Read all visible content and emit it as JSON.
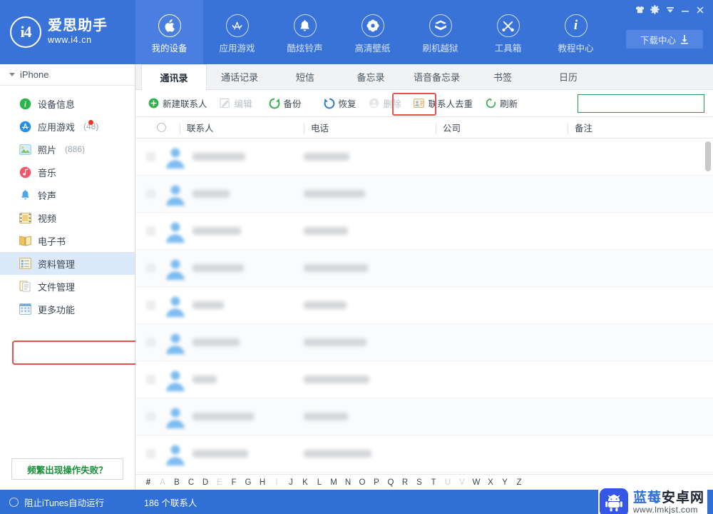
{
  "brand": {
    "logo_text": "i4",
    "name": "爱思助手",
    "url": "www.i4.cn",
    "logo_icon": "i4-circle-logo"
  },
  "topnav": {
    "items": [
      {
        "label": "我的设备",
        "icon": "apple-icon",
        "active": true
      },
      {
        "label": "应用游戏",
        "icon": "appstore-icon",
        "active": false
      },
      {
        "label": "酷炫铃声",
        "icon": "bell-icon",
        "active": false
      },
      {
        "label": "高清壁纸",
        "icon": "flower-wallpaper-icon",
        "active": false
      },
      {
        "label": "刷机越狱",
        "icon": "open-box-icon",
        "active": false
      },
      {
        "label": "工具箱",
        "icon": "tools-icon",
        "active": false
      },
      {
        "label": "教程中心",
        "icon": "info-icon",
        "active": false
      }
    ]
  },
  "window": {
    "buttons": [
      {
        "name": "skin-icon",
        "glyph": "👕"
      },
      {
        "name": "gear-icon",
        "glyph": "✾"
      },
      {
        "name": "tray-down-icon",
        "glyph": "▼"
      },
      {
        "name": "minimize-icon",
        "glyph": "—"
      },
      {
        "name": "close-icon",
        "glyph": "✕"
      }
    ],
    "download_center": {
      "label": "下载中心",
      "icon": "download-icon"
    }
  },
  "sidebar": {
    "device": {
      "label": "iPhone",
      "icon": "collapse-triangle-icon"
    },
    "items": [
      {
        "label": "设备信息",
        "count": "",
        "icon": "info-circle-icon",
        "badge": false,
        "selected": false
      },
      {
        "label": "应用游戏",
        "count": "(48)",
        "icon": "appstore-circle-icon",
        "badge": true,
        "selected": false
      },
      {
        "label": "照片",
        "count": "(886)",
        "icon": "photo-icon",
        "badge": false,
        "selected": false
      },
      {
        "label": "音乐",
        "count": "",
        "icon": "music-icon",
        "badge": false,
        "selected": false
      },
      {
        "label": "铃声",
        "count": "",
        "icon": "ringtone-bell-icon",
        "badge": false,
        "selected": false
      },
      {
        "label": "视频",
        "count": "",
        "icon": "video-film-icon",
        "badge": false,
        "selected": false
      },
      {
        "label": "电子书",
        "count": "",
        "icon": "ebook-icon",
        "badge": false,
        "selected": false
      },
      {
        "label": "资料管理",
        "count": "",
        "icon": "data-manage-icon",
        "badge": false,
        "selected": true
      },
      {
        "label": "文件管理",
        "count": "",
        "icon": "file-manage-icon",
        "badge": false,
        "selected": false
      },
      {
        "label": "更多功能",
        "count": "",
        "icon": "more-features-icon",
        "badge": false,
        "selected": false
      }
    ],
    "fail_button": {
      "label": "频繁出现操作失败？"
    }
  },
  "tabs": [
    {
      "label": "通讯录",
      "active": true
    },
    {
      "label": "通话记录",
      "active": false
    },
    {
      "label": "短信",
      "active": false
    },
    {
      "label": "备忘录",
      "active": false
    },
    {
      "label": "语音备忘录",
      "active": false
    },
    {
      "label": "书签",
      "active": false
    },
    {
      "label": "日历",
      "active": false
    }
  ],
  "toolbar": {
    "buttons": [
      {
        "label": "新建联系人",
        "icon": "plus-circle-icon",
        "disabled": false,
        "highlighted": false
      },
      {
        "label": "编辑",
        "icon": "pencil-edit-icon",
        "disabled": true,
        "highlighted": false
      },
      {
        "label": "备份",
        "icon": "backup-circle-arrow-icon",
        "disabled": false,
        "highlighted": true
      },
      {
        "label": "恢复",
        "icon": "restore-circle-arrow-icon",
        "disabled": false,
        "highlighted": false
      },
      {
        "label": "删除",
        "icon": "delete-person-icon",
        "disabled": true,
        "highlighted": false
      },
      {
        "label": "联系人去重",
        "icon": "dedupe-card-icon",
        "disabled": false,
        "highlighted": false
      },
      {
        "label": "刷新",
        "icon": "refresh-icon",
        "disabled": false,
        "highlighted": false
      }
    ],
    "search": {
      "value": "",
      "placeholder": "",
      "icon": "search-icon"
    }
  },
  "table": {
    "columns": [
      "联系人",
      "电话",
      "公司",
      "备注"
    ],
    "select_all_icon": "select-all-circle-icon",
    "rows": [
      {
        "name": "",
        "phone": "",
        "company": "",
        "note": "",
        "name_w": 78,
        "phone_w": 95
      },
      {
        "name": "",
        "phone": "",
        "company": "",
        "note": "",
        "name_w": 86,
        "phone_w": 62
      },
      {
        "name": "",
        "phone": "",
        "company": "",
        "note": "",
        "name_w": 34,
        "phone_w": 92
      },
      {
        "name": "",
        "phone": "",
        "company": "",
        "note": "",
        "name_w": 66,
        "phone_w": 88
      },
      {
        "name": "",
        "phone": "",
        "company": "",
        "note": "",
        "name_w": 44,
        "phone_w": 60
      },
      {
        "name": "",
        "phone": "",
        "company": "",
        "note": "",
        "name_w": 72,
        "phone_w": 90
      },
      {
        "name": "",
        "phone": "",
        "company": "",
        "note": "",
        "name_w": 68,
        "phone_w": 62
      },
      {
        "name": "",
        "phone": "",
        "company": "",
        "note": "",
        "name_w": 52,
        "phone_w": 86
      },
      {
        "name": "",
        "phone": "",
        "company": "",
        "note": "",
        "name_w": 74,
        "phone_w": 64
      }
    ]
  },
  "alphabet": [
    {
      "ch": "#",
      "enabled": true
    },
    {
      "ch": "A",
      "enabled": false
    },
    {
      "ch": "B",
      "enabled": true
    },
    {
      "ch": "C",
      "enabled": true
    },
    {
      "ch": "D",
      "enabled": true
    },
    {
      "ch": "E",
      "enabled": false
    },
    {
      "ch": "F",
      "enabled": true
    },
    {
      "ch": "G",
      "enabled": true
    },
    {
      "ch": "H",
      "enabled": true
    },
    {
      "ch": "I",
      "enabled": false
    },
    {
      "ch": "J",
      "enabled": true
    },
    {
      "ch": "K",
      "enabled": true
    },
    {
      "ch": "L",
      "enabled": true
    },
    {
      "ch": "M",
      "enabled": true
    },
    {
      "ch": "N",
      "enabled": true
    },
    {
      "ch": "O",
      "enabled": true
    },
    {
      "ch": "P",
      "enabled": true
    },
    {
      "ch": "Q",
      "enabled": true
    },
    {
      "ch": "R",
      "enabled": true
    },
    {
      "ch": "S",
      "enabled": true
    },
    {
      "ch": "T",
      "enabled": true
    },
    {
      "ch": "U",
      "enabled": false
    },
    {
      "ch": "V",
      "enabled": false
    },
    {
      "ch": "W",
      "enabled": true
    },
    {
      "ch": "X",
      "enabled": true
    },
    {
      "ch": "Y",
      "enabled": true
    },
    {
      "ch": "Z",
      "enabled": true
    }
  ],
  "statusbar": {
    "itunes_toggle": {
      "label": "阻止iTunes自动运行",
      "icon": "radio-circle-icon"
    },
    "count_text": "186 个联系人"
  },
  "watermark": {
    "title_blue": "蓝莓",
    "title_dark": "安卓网",
    "url": "www.lmkjst.com",
    "icon": "android-crown-logo"
  },
  "colors": {
    "header_blue": "#3a73d8",
    "nav_active": "#4a7fe0",
    "annotation_red": "#e0524c",
    "search_green": "#1f9b4b",
    "selected_row": "#dce9f8",
    "status_blue": "#2f6fd6"
  }
}
